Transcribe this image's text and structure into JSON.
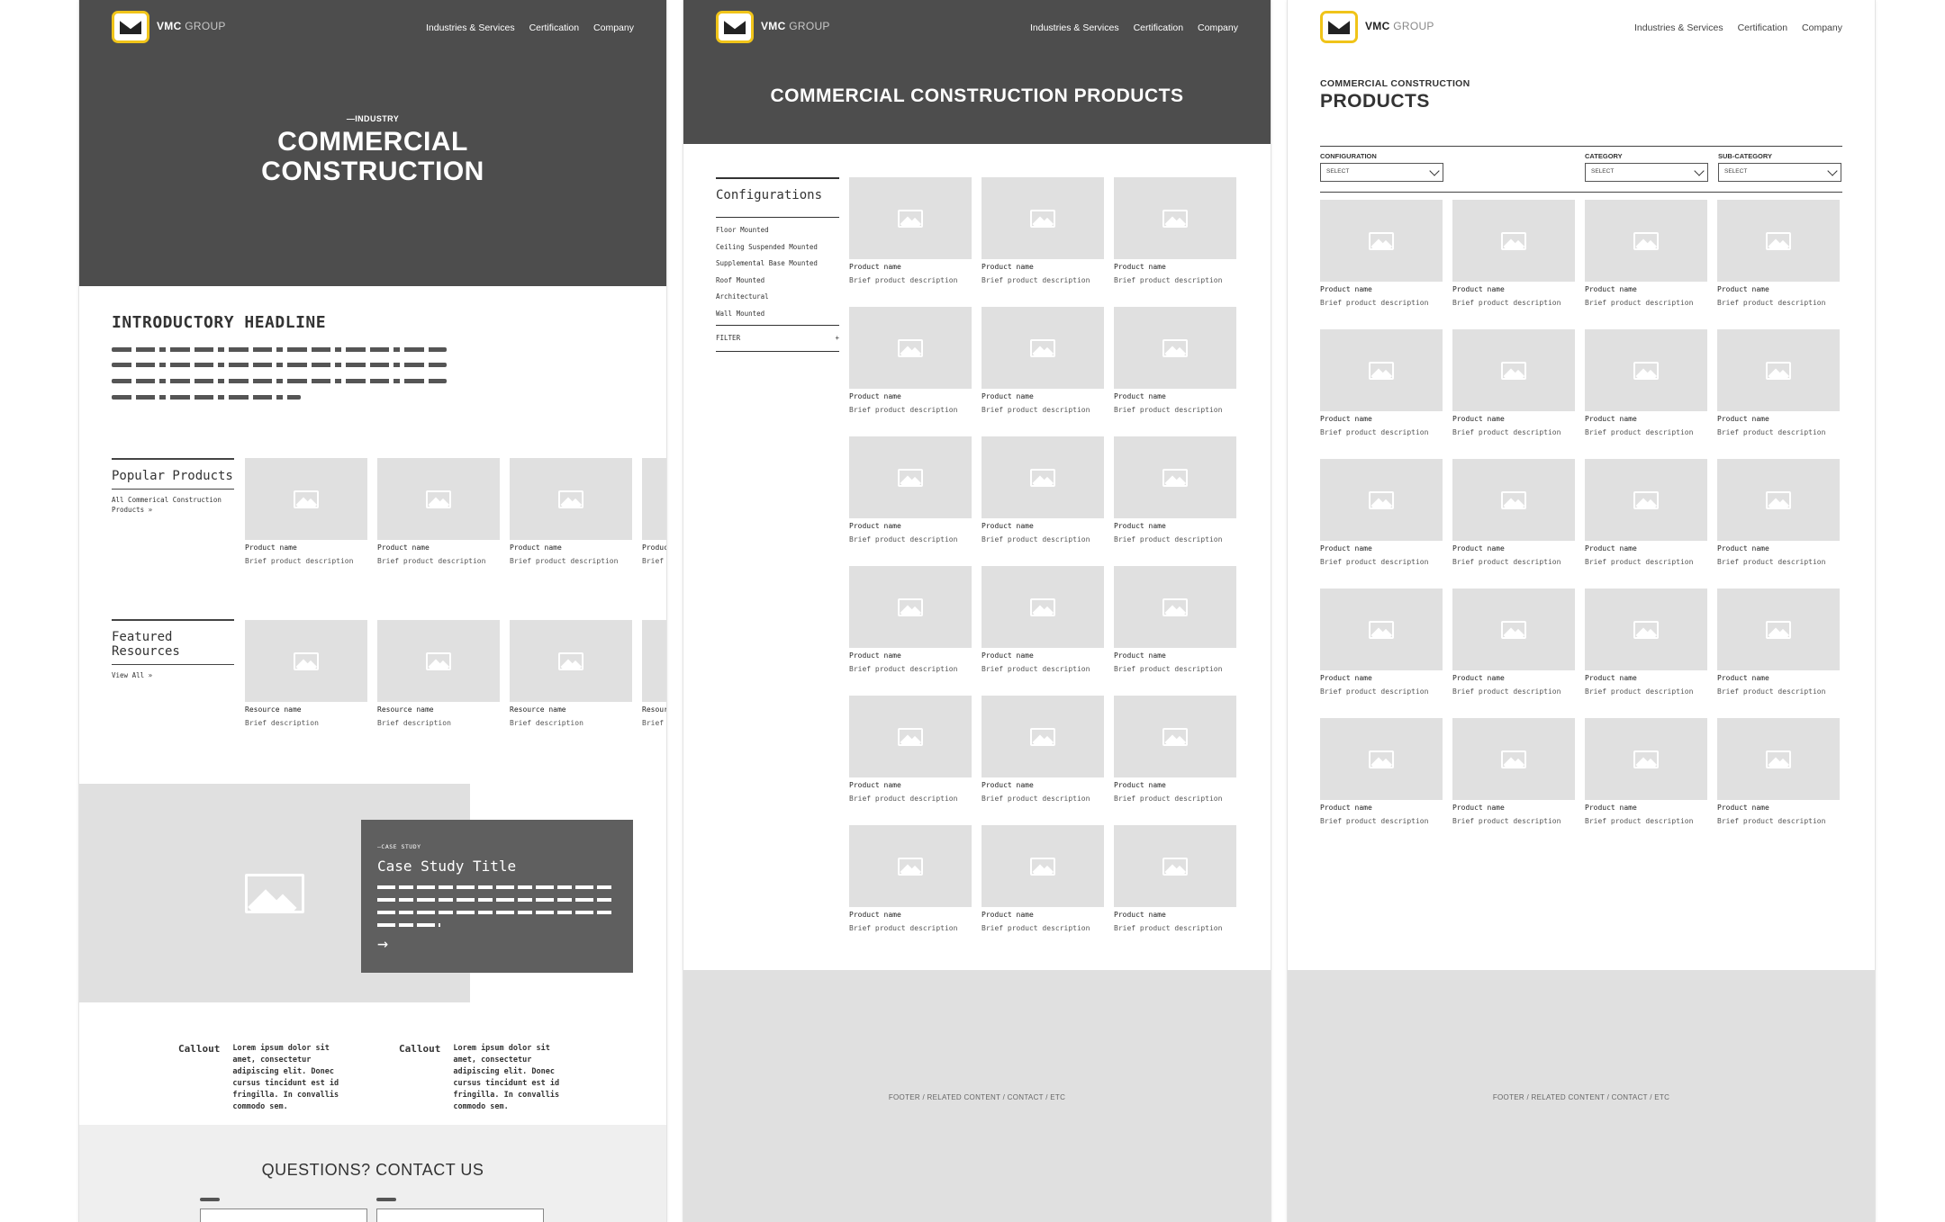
{
  "brand": {
    "bold": "VMC",
    "light": "GROUP"
  },
  "nav": [
    "Industries & Services",
    "Certification",
    "Company"
  ],
  "page1": {
    "hero_eyebrow": "—INDUSTRY",
    "hero_title": "COMMERCIAL CONSTRUCTION",
    "intro_headline": "INTRODUCTORY HEADLINE",
    "popular_title": "Popular Products",
    "popular_link": "All Commerical Construction Products »",
    "popular_items": [
      {
        "name": "Product name",
        "desc": "Brief product description"
      },
      {
        "name": "Product name",
        "desc": "Brief product description"
      },
      {
        "name": "Product name",
        "desc": "Brief product description"
      },
      {
        "name": "Produc",
        "desc": "Brief p"
      }
    ],
    "featured_title": "Featured Resources",
    "featured_link": "View All »",
    "featured_items": [
      {
        "name": "Resource name",
        "desc": "Brief description"
      },
      {
        "name": "Resource name",
        "desc": "Brief description"
      },
      {
        "name": "Resource name",
        "desc": "Brief description"
      },
      {
        "name": "Resour",
        "desc": "Brief c"
      }
    ],
    "case_eyebrow": "—CASE STUDY",
    "case_title": "Case Study Title",
    "case_arrow": "→",
    "callouts": [
      {
        "label": "Callout",
        "text": "Lorem ipsum dolor sit amet, consectetur adipiscing elit. Donec cursus tincidunt est id fringilla. In convallis commodo sem."
      },
      {
        "label": "Callout",
        "text": "Lorem ipsum dolor sit amet, consectetur adipiscing elit. Donec cursus tincidunt est id fringilla. In convallis commodo sem."
      }
    ],
    "contact_title": "QUESTIONS? CONTACT US"
  },
  "page2": {
    "hero_title": "COMMERCIAL CONSTRUCTION PRODUCTS",
    "config_title": "Configurations",
    "config_items": [
      "Floor Mounted",
      "Ceiling Suspended Mounted",
      "Supplemental Base Mounted",
      "Roof Mounted",
      "Architectural",
      "Wall Mounted"
    ],
    "filter_label": "FILTER",
    "filter_toggle": "+",
    "product_name": "Product name",
    "product_desc": "Brief product description",
    "footer": "FOOTER / RELATED CONTENT / CONTACT / ETC"
  },
  "page3": {
    "eyebrow": "COMMERCIAL CONSTRUCTION",
    "title": "PRODUCTS",
    "filters": [
      {
        "label": "CONFIGURATION",
        "value": "SELECT"
      },
      {
        "label": "CATEGORY",
        "value": "SELECT"
      },
      {
        "label": "SUB-CATEGORY",
        "value": "SELECT"
      }
    ],
    "product_name": "Product name",
    "product_desc": "Brief product description",
    "footer": "FOOTER / RELATED CONTENT / CONTACT / ETC"
  },
  "colors": {
    "hero": "#4d4d4d",
    "placeholder": "#e0e0e0",
    "logo_accent": "#f0c419",
    "footer": "#e0e0e0"
  }
}
